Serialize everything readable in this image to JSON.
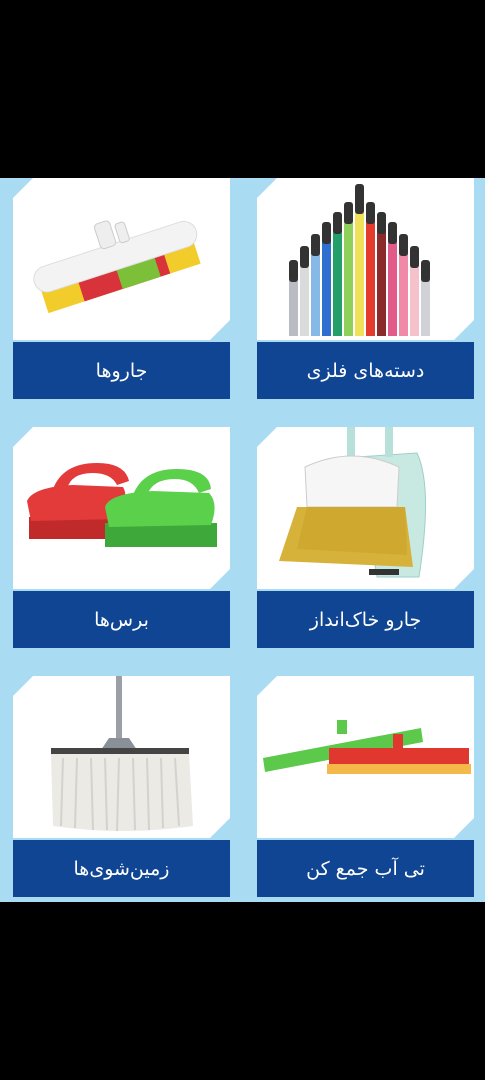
{
  "categories": [
    {
      "label": "دسته‌های فلزی",
      "icon": "colored-handles-image"
    },
    {
      "label": "جاروها",
      "icon": "scrub-broom-head-image"
    },
    {
      "label": "جارو خاک‌انداز",
      "icon": "broom-dustpan-image"
    },
    {
      "label": "برس‌ها",
      "icon": "scrub-brushes-image"
    },
    {
      "label": "تی آب جمع کن",
      "icon": "floor-squeegee-image"
    },
    {
      "label": "زمین‌شوی‌ها",
      "icon": "string-mop-image"
    }
  ]
}
